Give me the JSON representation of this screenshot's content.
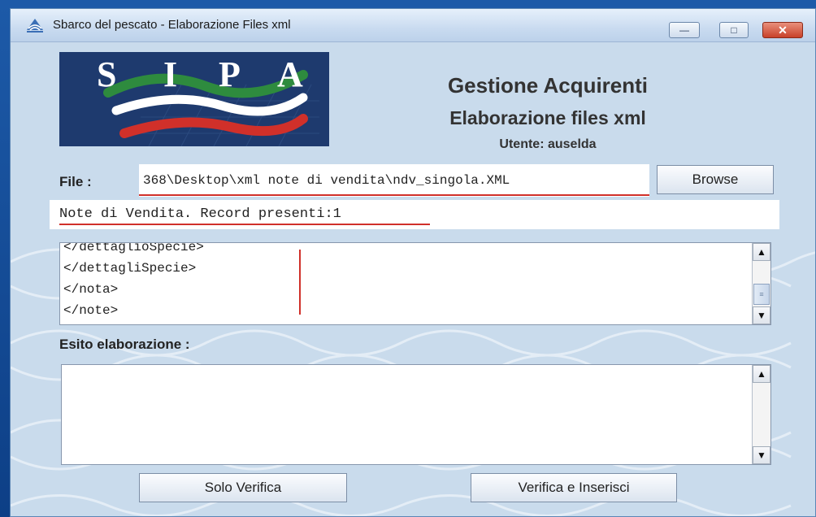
{
  "window": {
    "title": "Sbarco del pescato - Elaborazione Files xml",
    "controls": {
      "minimize": "—",
      "maximize": "□",
      "close": "✕"
    }
  },
  "logo": {
    "letters": [
      "S",
      "I",
      "P",
      "A"
    ],
    "colors": {
      "background": "#1e3a6e",
      "green": "#2e8b3e",
      "white": "#ffffff",
      "red": "#d0302a"
    }
  },
  "header": {
    "title": "Gestione Acquirenti",
    "subtitle": "Elaborazione files xml",
    "user": "Utente: auselda"
  },
  "file": {
    "label": "File :",
    "value": "368\\Desktop\\xml note di vendita\\ndv_singola.XML",
    "browse_label": "Browse"
  },
  "status": {
    "text": "Note di Vendita. Record presenti:1"
  },
  "xml_view": {
    "lines": [
      "</dettaglioSpecie>",
      "</dettagliSpecie>",
      "</nota>",
      "</note>"
    ]
  },
  "esito": {
    "label": "Esito elaborazione :",
    "value": ""
  },
  "buttons": {
    "solo_verifica": "Solo Verifica",
    "verifica_inserisci": "Verifica e Inserisci"
  },
  "colors": {
    "annotation_red": "#d0302a",
    "window_bg": "#c9dbec",
    "desktop": "#1d5aa8"
  }
}
